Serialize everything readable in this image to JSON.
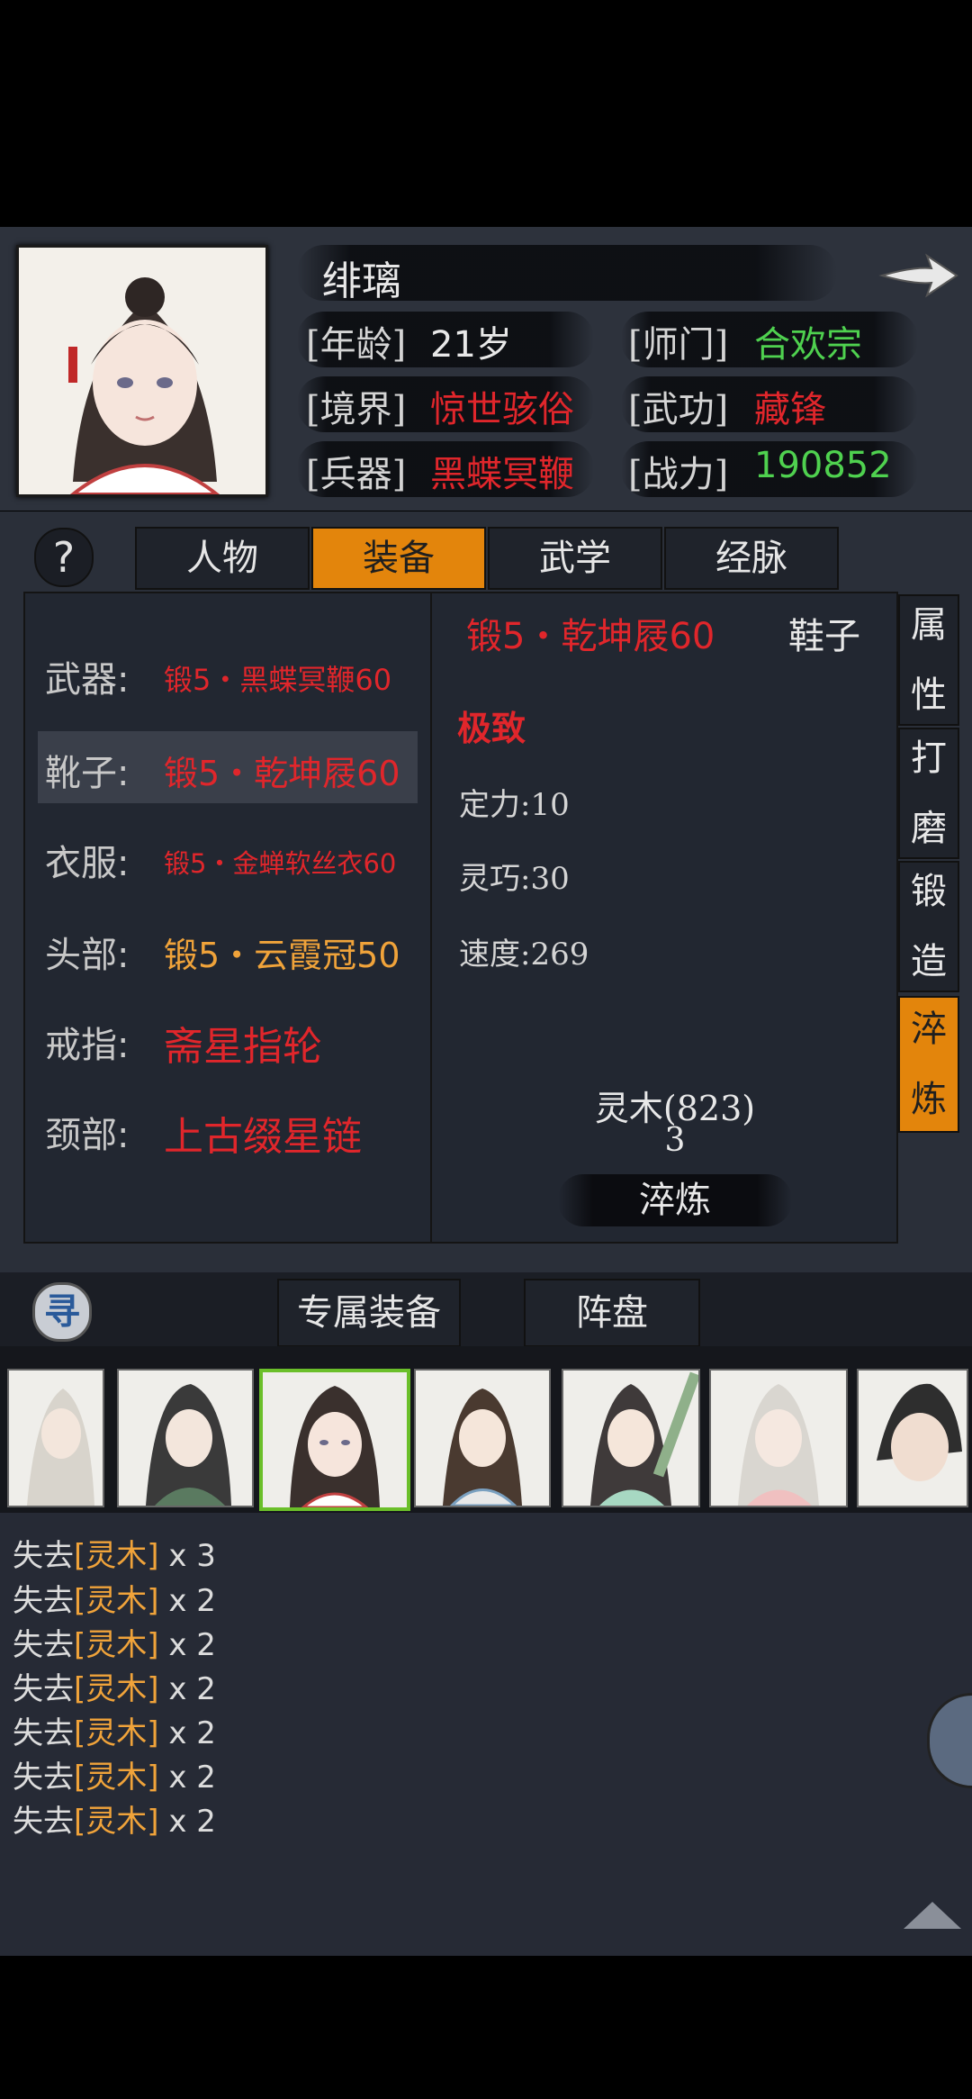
{
  "character": {
    "name": "绯璃",
    "age_label": "[年龄]",
    "age": "21岁",
    "sect_label": "[师门]",
    "sect": "合欢宗",
    "realm_label": "[境界]",
    "realm": "惊世骇俗",
    "skill_label": "[武功]",
    "skill": "藏锋",
    "weapon_label": "[兵器]",
    "weapon": "黑蝶冥鞭",
    "power_label": "[战力]",
    "power": "190852"
  },
  "tabs": [
    "人物",
    "装备",
    "武学",
    "经脉"
  ],
  "help_label": "?",
  "equipment": [
    {
      "label": "武器:",
      "value": "锻5・黑蝶冥鞭60",
      "color": "#e0262b",
      "size": "small"
    },
    {
      "label": "靴子:",
      "value": "锻5・乾坤屐60",
      "color": "#e0262b",
      "size": "medium"
    },
    {
      "label": "衣服:",
      "value": "锻5・金蝉软丝衣60",
      "color": "#e0262b",
      "size": "xsmall"
    },
    {
      "label": "头部:",
      "value": "锻5・云霞冠50",
      "color": "#f0a33a",
      "size": "medium"
    },
    {
      "label": "戒指:",
      "value": "斋星指轮",
      "color": "#e0262b",
      "size": "large"
    },
    {
      "label": "颈部:",
      "value": "上古缀星链",
      "color": "#e0262b",
      "size": "large"
    }
  ],
  "detail": {
    "item_name": "锻5・乾坤屐60",
    "slot": "鞋子",
    "quality": "极致",
    "stats": [
      "定力:10",
      "灵巧:30",
      "速度:269"
    ],
    "material": "灵木(823)",
    "cost": "3",
    "action": "淬炼"
  },
  "side_buttons": [
    {
      "top": "属",
      "bottom": "性"
    },
    {
      "top": "打",
      "bottom": "磨"
    },
    {
      "top": "锻",
      "bottom": "造"
    },
    {
      "top": "淬",
      "bottom": "炼"
    }
  ],
  "bottom_tabs": [
    "专属装备",
    "阵盘"
  ],
  "seek_icon_label": "寻",
  "log": [
    {
      "prefix": "失去",
      "item": "[灵木]",
      "qty": "x 3"
    },
    {
      "prefix": "失去",
      "item": "[灵木]",
      "qty": "x 2"
    },
    {
      "prefix": "失去",
      "item": "[灵木]",
      "qty": "x 2"
    },
    {
      "prefix": "失去",
      "item": "[灵木]",
      "qty": "x 2"
    },
    {
      "prefix": "失去",
      "item": "[灵木]",
      "qty": "x 2"
    },
    {
      "prefix": "失去",
      "item": "[灵木]",
      "qty": "x 2"
    },
    {
      "prefix": "失去",
      "item": "[灵木]",
      "qty": "x 2"
    }
  ],
  "colors": {
    "accent": "#e3850c",
    "red": "#e0262b",
    "green": "#4fd14f",
    "orange_item": "#f0a33a"
  }
}
